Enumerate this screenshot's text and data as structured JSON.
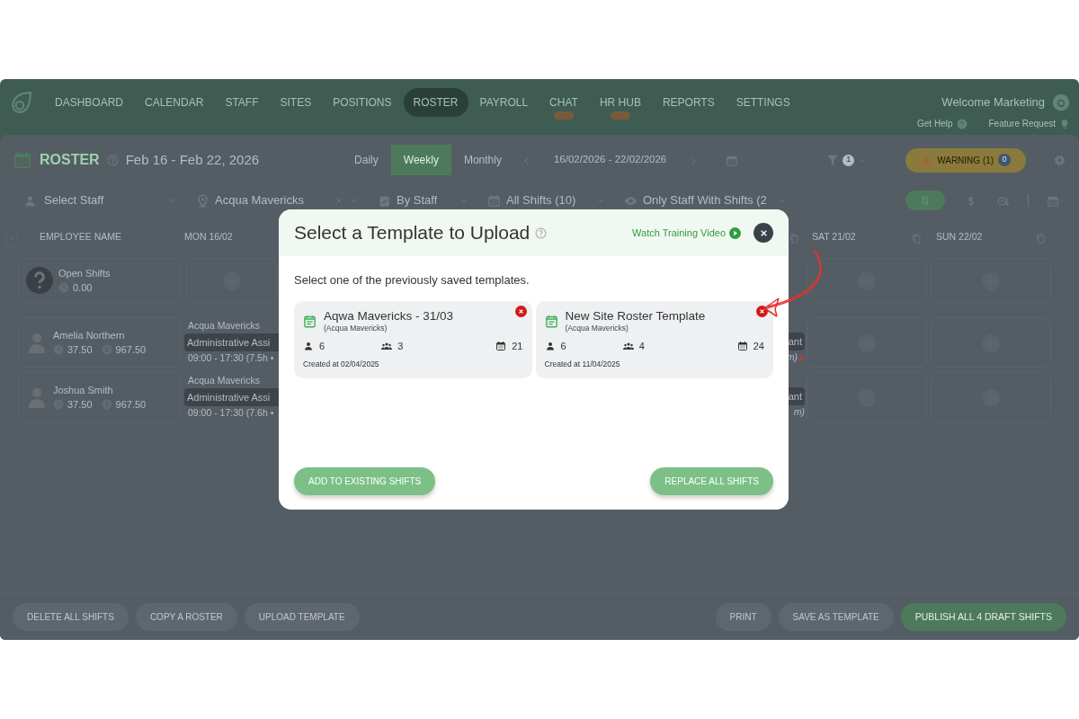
{
  "nav": {
    "items": [
      {
        "label": "DASHBOARD",
        "selected": false,
        "badge": false
      },
      {
        "label": "CALENDAR",
        "selected": false,
        "badge": false
      },
      {
        "label": "STAFF",
        "selected": false,
        "badge": false
      },
      {
        "label": "SITES",
        "selected": false,
        "badge": false
      },
      {
        "label": "POSITIONS",
        "selected": false,
        "badge": false
      },
      {
        "label": "ROSTER",
        "selected": true,
        "badge": false
      },
      {
        "label": "PAYROLL",
        "selected": false,
        "badge": false
      },
      {
        "label": "CHAT",
        "selected": false,
        "badge": true
      },
      {
        "label": "HR HUB",
        "selected": false,
        "badge": true
      },
      {
        "label": "REPORTS",
        "selected": false,
        "badge": false
      },
      {
        "label": "SETTINGS",
        "selected": false,
        "badge": false
      }
    ],
    "welcome": "Welcome Marketing",
    "links": [
      {
        "label": "Get Help",
        "kind": "help"
      },
      {
        "label": "Feature Request",
        "kind": "idea"
      }
    ]
  },
  "toolbar": {
    "title": "ROSTER",
    "range": "Feb 16 - Feb 22, 2026",
    "views": [
      {
        "label": "Daily",
        "selected": false
      },
      {
        "label": "Weekly",
        "selected": true
      },
      {
        "label": "Monthly",
        "selected": false
      }
    ],
    "date_range": "16/02/2026 - 22/02/2026",
    "filter_count": "1",
    "warning": "WARNING (1)",
    "warning_count": "0"
  },
  "filters": [
    {
      "kind": "staff",
      "placeholder": "Select Staff"
    },
    {
      "kind": "site",
      "value": "Acqua Mavericks"
    },
    {
      "kind": "group",
      "value": "By Staff"
    },
    {
      "kind": "shifts",
      "value": "All Shifts (10)"
    },
    {
      "kind": "visibility",
      "value": "Only Staff With Shifts (2"
    }
  ],
  "columns": {
    "name": "EMPLOYEE NAME",
    "days": [
      "MON 16/02",
      "SAT 21/02",
      "SUN 22/02"
    ]
  },
  "rows": [
    {
      "kind": "open",
      "name": "Open Shifts",
      "hours": "0.00"
    },
    {
      "kind": "staff",
      "name": "Amelia Northern",
      "hours": "37.50",
      "pay": "967.50",
      "mon": {
        "site": "Acqua Mavericks",
        "position": "Administrative Assi",
        "time": "09:00 - 17:30 (7.5h •"
      },
      "fri": {
        "position": "ant",
        "time": "m)",
        "alert": true
      }
    },
    {
      "kind": "staff",
      "name": "Joshua Smith",
      "hours": "37.50",
      "pay": "967.50",
      "mon": {
        "site": "Acqua Mavericks",
        "position": "Administrative Assi",
        "time": "09:00 - 17:30 (7.6h •"
      },
      "fri": {
        "position": "ant",
        "time": "m)",
        "alert": false
      }
    }
  ],
  "bottom": {
    "left": [
      "DELETE ALL SHIFTS",
      "COPY A ROSTER",
      "UPLOAD TEMPLATE"
    ],
    "right": [
      {
        "label": "PRINT",
        "kind": "plain"
      },
      {
        "label": "SAVE AS TEMPLATE",
        "kind": "plain"
      },
      {
        "label": "PUBLISH ALL 4 DRAFT SHIFTS",
        "kind": "primary"
      }
    ]
  },
  "modal": {
    "title": "Select a Template to Upload",
    "video_link": "Watch Training Video",
    "intro": "Select one of the previously saved templates.",
    "templates": [
      {
        "name": "Aqwa Mavericks - 31/03",
        "site": "(Acqua Mavericks)",
        "staff": "6",
        "positions": "3",
        "days": "21",
        "created": "Created at 02/04/2025"
      },
      {
        "name": "New Site Roster Template",
        "site": "(Acqua Mavericks)",
        "staff": "6",
        "positions": "4",
        "days": "24",
        "created": "Created at 11/04/2025"
      }
    ],
    "actions": [
      "ADD TO EXISTING SHIFTS",
      "REPLACE ALL SHIFTS"
    ]
  }
}
